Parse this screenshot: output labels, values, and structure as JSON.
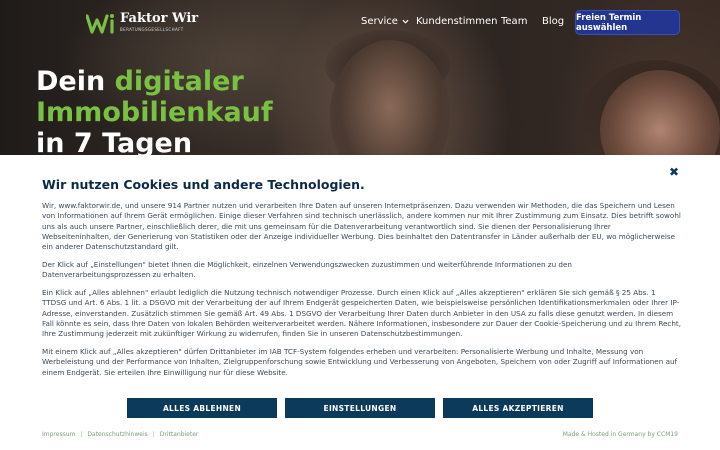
{
  "brand": {
    "name": "Faktor Wir",
    "subtitle": "BERATUNGSGESELLSCHAFT",
    "accent": "#7ac143"
  },
  "nav": {
    "items": [
      {
        "label": "Service"
      },
      {
        "label": "Kundenstimmen"
      },
      {
        "label": "Team"
      },
      {
        "label": "Blog"
      }
    ],
    "cta_label": "Freien Termin auswählen",
    "cta_color": "#23358e"
  },
  "hero": {
    "line1_plain": "Dein ",
    "line1_accent": "digitaler",
    "line2_accent": "Immobilienkauf",
    "line3_plain": "in 7 Tagen"
  },
  "cookie": {
    "title": "Wir nutzen Cookies und andere Technologien.",
    "paragraphs": [
      "Wir, www.faktorwir.de, und unsere 914 Partner nutzen und verarbeiten Ihre Daten auf unseren Internetpräsenzen. Dazu verwenden wir Methoden, die das Speichern und Lesen von Informationen auf Ihrem Gerät ermöglichen. Einige dieser Verfahren sind technisch unerlässlich, andere kommen nur mit Ihrer Zustimmung zum Einsatz. Dies betrifft sowohl uns als auch unsere Partner, einschließlich derer, die mit uns gemeinsam für die Datenverarbeitung verantwortlich sind. Sie dienen der Personalisierung Ihrer Webseiteninhalten, der Generierung von Statistiken oder der Anzeige individueller Werbung. Dies beinhaltet den Datentransfer in Länder außerhalb der EU, wo möglicherweise ein anderer Datenschutzstandard gilt.",
      "Der Klick auf „Einstellungen\" bietet Ihnen die Möglichkeit, einzelnen Verwendungszwecken zuzustimmen und weiterführende Informationen zu den Datenverarbeitungsprozessen zu erhalten.",
      "Ein Klick auf „Alles ablehnen\" erlaubt lediglich die Nutzung technisch notwendiger Prozesse. Durch einen Klick auf „Alles akzeptieren\" erklären Sie sich gemäß § 25 Abs. 1 TTDSG und Art. 6 Abs. 1 lit. a DSGVO mit der Verarbeitung der auf Ihrem Endgerät gespeicherten Daten, wie beispielsweise persönlichen Identifikationsmerkmalen oder Ihrer IP-Adresse, einverstanden. Zusätzlich stimmen Sie gemäß Art. 49 Abs. 1 DSGVO der Verarbeitung Ihrer Daten durch Anbieter in den USA zu falls diese genutzt werden. In diesem Fall könnte es sein, dass Ihre Daten von lokalen Behörden weiterverarbeitet werden. Nähere Informationen, insbesondere zur Dauer der Cookie-Speicherung und zu Ihrem Recht, Ihre Zustimmung jederzeit mit zukünftiger Wirkung zu widerrufen, finden Sie in unseren Datenschutzbestimmungen.",
      "Mit einem Klick auf „Alles akzeptieren\" dürfen Drittanbieter im IAB TCF-System folgendes erheben und verarbeiten: Personalisierte Werbung und Inhalte, Messung von Werbeleistung und der Performance von Inhalten, Zielgruppenforschung sowie Entwicklung und Verbesserung von Angeboten, Speichern von oder Zugriff auf Informationen auf einem Endgerät. Sie erteilen Ihre Einwilligung nur für diese Website."
    ],
    "buttons": {
      "reject": "ALLES ABLEHNEN",
      "settings": "EINSTELLUNGEN",
      "accept": "ALLES AKZEPTIEREN"
    },
    "button_color": "#0b3a5a",
    "footer_links": [
      "Impressum",
      "Datenschutzhinweis",
      "Drittanbieter"
    ],
    "hosted": "Made & Hosted in Germany by CCM19",
    "close_icon": "close-icon"
  }
}
